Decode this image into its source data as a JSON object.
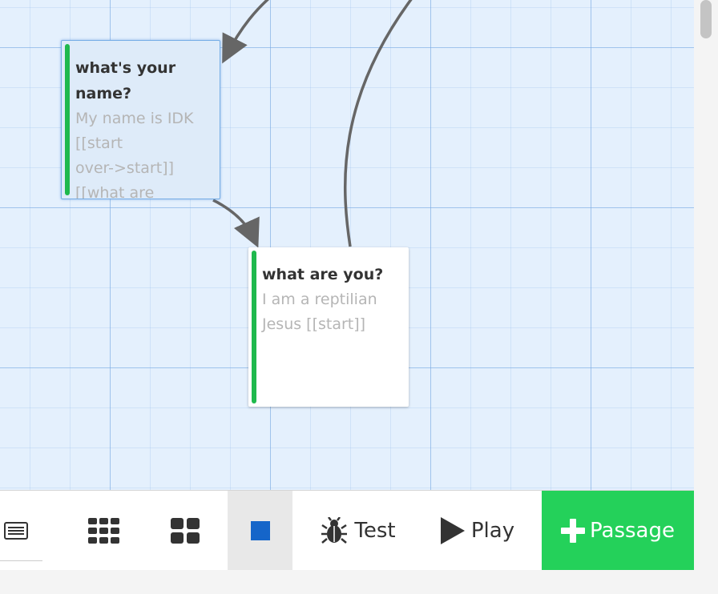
{
  "passages": [
    {
      "title": "what's your name?",
      "excerpt": "My name is IDK\n[[start\nover->start]]\n[[what are",
      "tag_color": "#1fb94d",
      "selected": true
    },
    {
      "title": "what are you?",
      "excerpt": "I am a reptilian\nJesus [[start]]",
      "tag_color": "#1fb94d",
      "selected": false
    }
  ],
  "toolbar": {
    "story_details_icon": "list-icon",
    "zoom_small_icon": "grid-9-icon",
    "zoom_medium_icon": "grid-4-icon",
    "zoom_large_icon": "square-icon",
    "test_label": "Test",
    "test_icon": "bug-icon",
    "play_label": "Play",
    "play_icon": "play-icon",
    "passage_label": "Passage",
    "passage_icon": "plus-icon",
    "accent_color": "#24d15a",
    "square_color": "#1565c9"
  }
}
